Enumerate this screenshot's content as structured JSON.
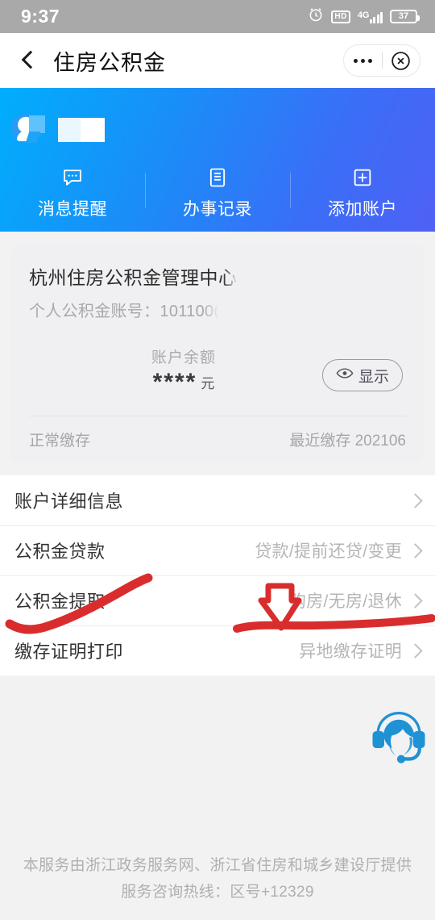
{
  "status_bar": {
    "time": "9:37",
    "alarm_icon": "alarm-clock-icon",
    "hd_label": "HD",
    "network_label": "4G",
    "battery_level": "37"
  },
  "nav": {
    "back_icon": "back-chevron-icon",
    "title": "住房公积金",
    "more_icon": "more-dots-icon",
    "close_icon": "close-circle-icon"
  },
  "hero": {
    "avatar_icon": "user-avatar-icon",
    "username": "",
    "actions": [
      {
        "label": "消息提醒",
        "icon": "message-bubble-icon"
      },
      {
        "label": "办事记录",
        "icon": "document-record-icon"
      },
      {
        "label": "添加账户",
        "icon": "plus-square-icon"
      }
    ],
    "gradient_start": "#00aefc",
    "gradient_end": "#4f61f5"
  },
  "account_card": {
    "title": "杭州住房公积金管理中心",
    "account_label": "个人公积金账号：101100(",
    "balance_label": "账户余额",
    "balance_value": "****",
    "balance_unit": "元",
    "show_button": "显示",
    "show_button_icon": "eye-icon",
    "status": "正常缴存",
    "last_deposit": "最近缴存 202106"
  },
  "menu": {
    "rows": [
      {
        "label": "账户详细信息",
        "hint": "",
        "chevron": "chevron-right-icon"
      },
      {
        "label": "公积金贷款",
        "hint": "贷款/提前还贷/变更",
        "chevron": "chevron-right-icon"
      },
      {
        "label": "公积金提取",
        "hint": "购房/无房/退休",
        "chevron": "chevron-right-icon"
      },
      {
        "label": "缴存证明打印",
        "hint": "异地缴存证明",
        "chevron": "chevron-right-icon"
      }
    ]
  },
  "service": {
    "icon": "customer-service-headset-icon",
    "color": "#1f92d4"
  },
  "footer": {
    "line1": "本服务由浙江政务服务网、浙江省住房和城乡建设厅提供",
    "line2": "服务咨询热线：区号+12329"
  },
  "annotations": {
    "color": "#d92d2d",
    "marks": [
      {
        "type": "curve-underline",
        "target": "公积金提取"
      },
      {
        "type": "down-arrow",
        "target": "购房/无房/退休"
      },
      {
        "type": "straight-underline",
        "target": "购房/无房/退休"
      }
    ]
  }
}
